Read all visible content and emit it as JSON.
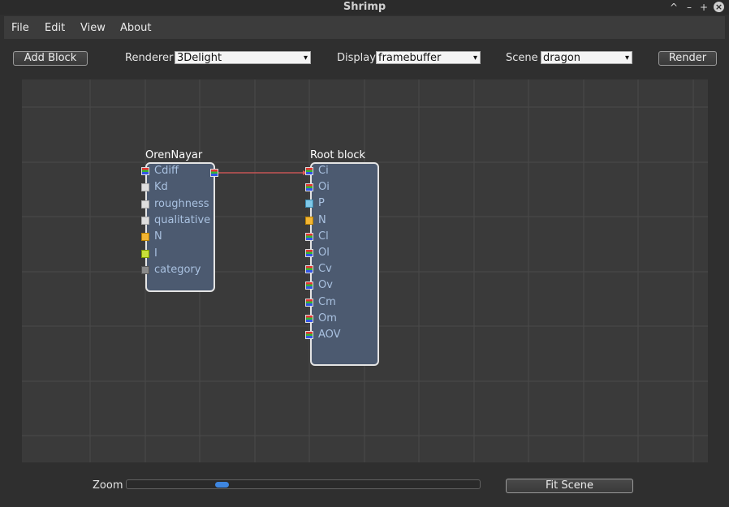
{
  "window": {
    "title": "Shrimp",
    "controls": [
      "^",
      "–",
      "+",
      "×"
    ]
  },
  "menu": [
    "File",
    "Edit",
    "View",
    "About"
  ],
  "toolbar": {
    "add_block": "Add Block",
    "renderer_label": "Renderer",
    "renderer_value": "3Delight",
    "display_label": "Display",
    "display_value": "framebuffer",
    "scene_label": "Scene",
    "scene_value": "dragon",
    "render": "Render"
  },
  "nodes": {
    "oren_nayar": {
      "title": "OrenNayar",
      "inputs": [
        {
          "name": "Cdiff",
          "type": "color"
        },
        {
          "name": "Kd",
          "type": "float"
        },
        {
          "name": "roughness",
          "type": "float"
        },
        {
          "name": "qualitative",
          "type": "float"
        },
        {
          "name": "N",
          "type": "normal"
        },
        {
          "name": "I",
          "type": "vector"
        },
        {
          "name": "category",
          "type": "string"
        }
      ],
      "output_type": "color"
    },
    "root": {
      "title": "Root block",
      "inputs": [
        {
          "name": "Ci",
          "type": "color"
        },
        {
          "name": "Oi",
          "type": "color"
        },
        {
          "name": "P",
          "type": "point"
        },
        {
          "name": "N",
          "type": "normal"
        },
        {
          "name": "Cl",
          "type": "color"
        },
        {
          "name": "Ol",
          "type": "color"
        },
        {
          "name": "Cv",
          "type": "color"
        },
        {
          "name": "Ov",
          "type": "color"
        },
        {
          "name": "Cm",
          "type": "color"
        },
        {
          "name": "Om",
          "type": "color"
        },
        {
          "name": "AOV",
          "type": "color"
        }
      ]
    }
  },
  "connection": {
    "from": "OrenNayar",
    "to": "Root block.Ci",
    "color": "#e05a5a"
  },
  "zoom": {
    "label": "Zoom",
    "value": 0.27
  },
  "fit_scene": "Fit Scene"
}
